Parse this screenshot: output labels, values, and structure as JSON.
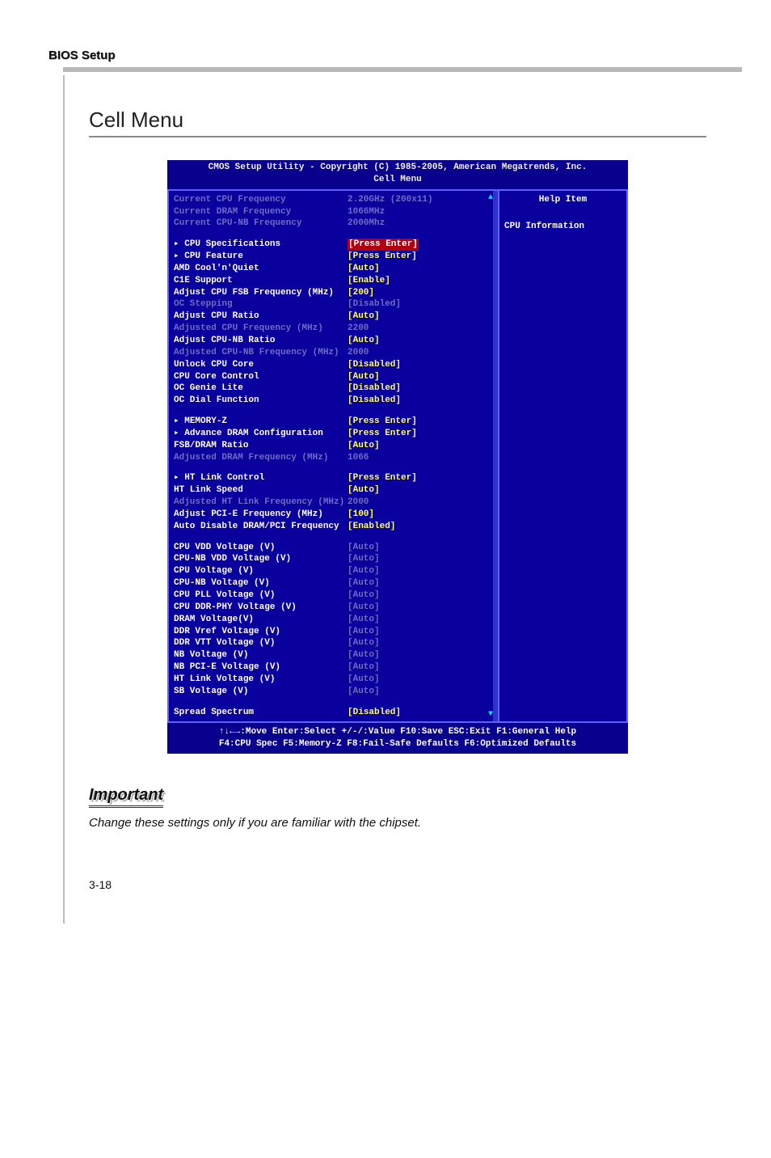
{
  "doc": {
    "header_label": "BIOS Setup",
    "section_title": "Cell Menu",
    "page_number": "3-18",
    "important_label": "Important",
    "important_text": "Change these settings only if you are familiar with the chipset."
  },
  "bios": {
    "title_l1": "CMOS Setup Utility - Copyright (C) 1985-2005, American Megatrends, Inc.",
    "title_l2": "Cell Menu",
    "help": {
      "title": "Help Item",
      "body": "CPU Information"
    },
    "footer_l1": "↑↓←→:Move  Enter:Select  +/-/:Value  F10:Save  ESC:Exit  F1:General Help",
    "footer_l2": "F4:CPU Spec  F5:Memory-Z  F8:Fail-Safe Defaults     F6:Optimized Defaults",
    "rows": [
      {
        "label": "Current CPU Frequency",
        "value": "2.20GHz (200x11)",
        "lcls": "gray",
        "vcls": "gray"
      },
      {
        "label": "Current DRAM Frequency",
        "value": "1066MHz",
        "lcls": "gray",
        "vcls": "gray"
      },
      {
        "label": "Current CPU-NB Frequency",
        "value": "2000Mhz",
        "lcls": "gray",
        "vcls": "gray"
      },
      {
        "spacer": true
      },
      {
        "label": "▸ CPU Specifications",
        "value": "[Press Enter]",
        "vcls": "highlight",
        "interact": true
      },
      {
        "label": "▸ CPU Feature",
        "value": "[Press Enter]",
        "interact": true
      },
      {
        "label": "AMD Cool'n'Quiet",
        "value": "[Auto]",
        "interact": true
      },
      {
        "label": "C1E Support",
        "value": "[Enable]",
        "interact": true
      },
      {
        "label": "Adjust CPU FSB Frequency (MHz)",
        "value": "[200]",
        "interact": true
      },
      {
        "label": "OC Stepping",
        "value": "[Disabled]",
        "lcls": "gray",
        "vcls": "gray",
        "interact": true
      },
      {
        "label": "Adjust CPU Ratio",
        "value": "[Auto]",
        "interact": true
      },
      {
        "label": "Adjusted CPU Frequency (MHz)",
        "value": "2200",
        "lcls": "gray",
        "vcls": "gray"
      },
      {
        "label": "Adjust CPU-NB Ratio",
        "value": "[Auto]",
        "interact": true
      },
      {
        "label": "Adjusted CPU-NB Frequency (MHz)",
        "value": "2000",
        "lcls": "gray",
        "vcls": "gray"
      },
      {
        "label": "Unlock CPU Core",
        "value": "[Disabled]",
        "interact": true
      },
      {
        "label": "CPU Core Control",
        "value": "[Auto]",
        "interact": true
      },
      {
        "label": "OC Genie Lite",
        "value": "[Disabled]",
        "interact": true
      },
      {
        "label": "OC Dial Function",
        "value": "[Disabled]",
        "interact": true
      },
      {
        "spacer": true
      },
      {
        "label": "▸ MEMORY-Z",
        "value": "[Press Enter]",
        "interact": true
      },
      {
        "label": "▸ Advance DRAM Configuration",
        "value": "[Press Enter]",
        "interact": true
      },
      {
        "label": "FSB/DRAM Ratio",
        "value": "[Auto]",
        "interact": true
      },
      {
        "label": "Adjusted DRAM Frequency (MHz)",
        "value": "1066",
        "lcls": "gray",
        "vcls": "gray"
      },
      {
        "spacer": true
      },
      {
        "label": "▸ HT Link Control",
        "value": "[Press Enter]",
        "interact": true
      },
      {
        "label": "HT Link Speed",
        "value": "[Auto]",
        "interact": true
      },
      {
        "label": "Adjusted HT Link Frequency (MHz)",
        "value": "2000",
        "lcls": "gray",
        "vcls": "gray"
      },
      {
        "label": "Adjust PCI-E Frequency (MHz)",
        "value": "[100]",
        "interact": true
      },
      {
        "label": "Auto Disable DRAM/PCI Frequency",
        "value": "[Enabled]",
        "interact": true
      },
      {
        "spacer": true
      },
      {
        "label": "CPU VDD Voltage (V)",
        "value": "[Auto]",
        "vcls": "gray",
        "interact": true
      },
      {
        "label": "CPU-NB VDD Voltage (V)",
        "value": "[Auto]",
        "vcls": "gray",
        "interact": true
      },
      {
        "label": "CPU Voltage (V)",
        "value": "[Auto]",
        "vcls": "gray",
        "interact": true
      },
      {
        "label": "CPU-NB Voltage (V)",
        "value": "[Auto]",
        "vcls": "gray",
        "interact": true
      },
      {
        "label": "CPU PLL Voltage (V)",
        "value": "[Auto]",
        "vcls": "gray",
        "interact": true
      },
      {
        "label": "CPU DDR-PHY Voltage (V)",
        "value": "[Auto]",
        "vcls": "gray",
        "interact": true
      },
      {
        "label": "DRAM Voltage(V)",
        "value": "[Auto]",
        "vcls": "gray",
        "interact": true
      },
      {
        "label": "DDR Vref Voltage (V)",
        "value": "[Auto]",
        "vcls": "gray",
        "interact": true
      },
      {
        "label": "DDR VTT Voltage (V)",
        "value": "[Auto]",
        "vcls": "gray",
        "interact": true
      },
      {
        "label": "NB Voltage (V)",
        "value": "[Auto]",
        "vcls": "gray",
        "interact": true
      },
      {
        "label": "NB PCI-E Voltage (V)",
        "value": "[Auto]",
        "vcls": "gray",
        "interact": true
      },
      {
        "label": "HT Link Voltage (V)",
        "value": "[Auto]",
        "vcls": "gray",
        "interact": true
      },
      {
        "label": "SB Voltage (V)",
        "value": "[Auto]",
        "vcls": "gray",
        "interact": true
      },
      {
        "spacer": true
      },
      {
        "label": "Spread Spectrum",
        "value": "[Disabled]",
        "interact": true
      }
    ]
  }
}
